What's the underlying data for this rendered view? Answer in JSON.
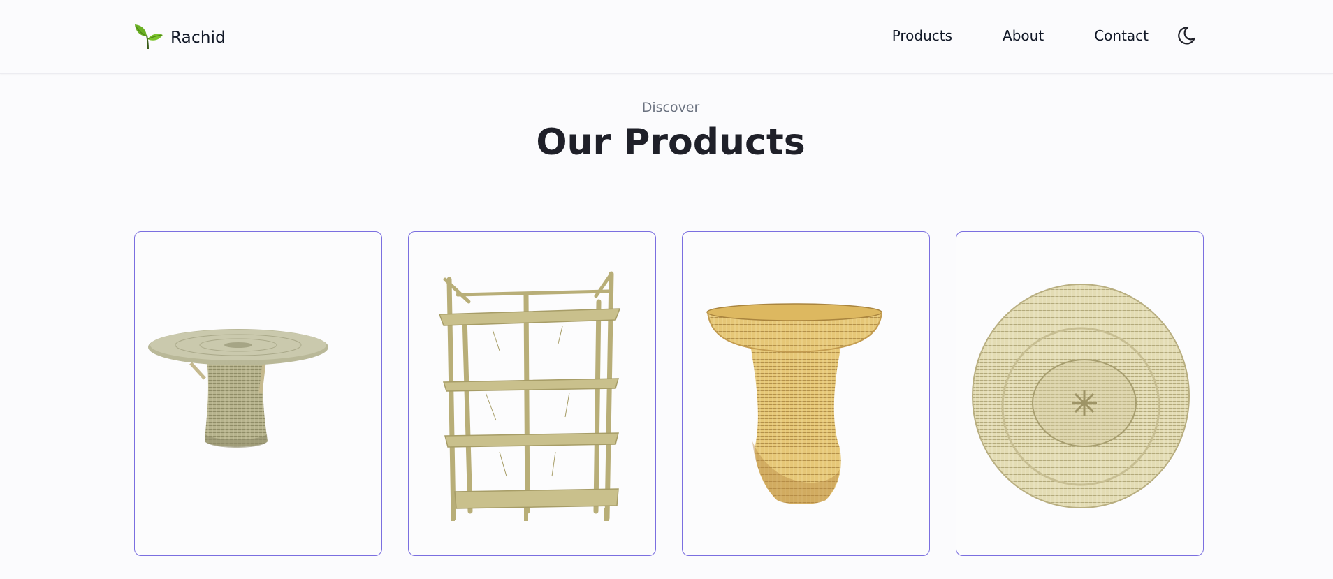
{
  "brand": {
    "name": "Rachid",
    "logo_icon": "sprout-icon",
    "logo_color": "#6ab023"
  },
  "nav": {
    "items": [
      {
        "label": "Products"
      },
      {
        "label": "About"
      },
      {
        "label": "Contact"
      }
    ],
    "theme_toggle_icon": "moon-icon"
  },
  "section": {
    "eyebrow": "Discover",
    "title": "Our Products"
  },
  "products": [
    {
      "image": "wicker-side-table"
    },
    {
      "image": "bamboo-shelf"
    },
    {
      "image": "wicker-pedestal-basket"
    },
    {
      "image": "wicker-round-chair"
    }
  ],
  "colors": {
    "card_border": "#7b6fe0",
    "background": "#fbfbfd",
    "text": "#111827"
  }
}
